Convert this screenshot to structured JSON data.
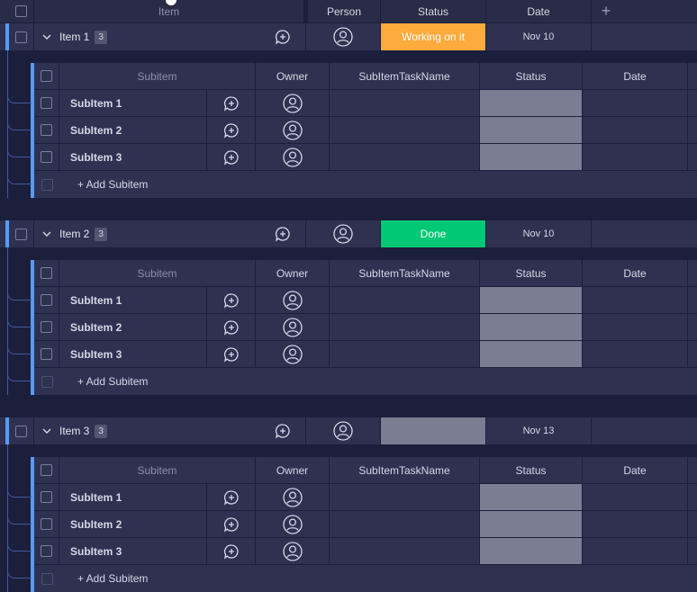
{
  "header": {
    "item_label": "Item",
    "person_label": "Person",
    "status_label": "Status",
    "date_label": "Date",
    "add_column_symbol": "+"
  },
  "subheader": {
    "subitem_label": "Subitem",
    "owner_label": "Owner",
    "taskname_label": "SubItemTaskName",
    "status_label": "Status",
    "date_label": "Date"
  },
  "add_subitem_label": "+ Add Subitem",
  "colors": {
    "working_on_it": "#fdab3d",
    "done": "#00c875",
    "empty_status": "#797e93",
    "group_accent": "#579bfc"
  },
  "groups": [
    {
      "name": "Item 1",
      "count": "3",
      "status": "Working on it",
      "status_color": "#fdab3d",
      "date": "Nov 10",
      "subitems": [
        "SubItem 1",
        "SubItem 2",
        "SubItem 3"
      ]
    },
    {
      "name": "Item 2",
      "count": "3",
      "status": "Done",
      "status_color": "#00c875",
      "date": "Nov 10",
      "subitems": [
        "SubItem 1",
        "SubItem 2",
        "SubItem 3"
      ]
    },
    {
      "name": "Item 3",
      "count": "3",
      "status": "",
      "status_color": "#797e93",
      "date": "Nov 13",
      "subitems": [
        "SubItem 1",
        "SubItem 2",
        "SubItem 3"
      ]
    }
  ]
}
